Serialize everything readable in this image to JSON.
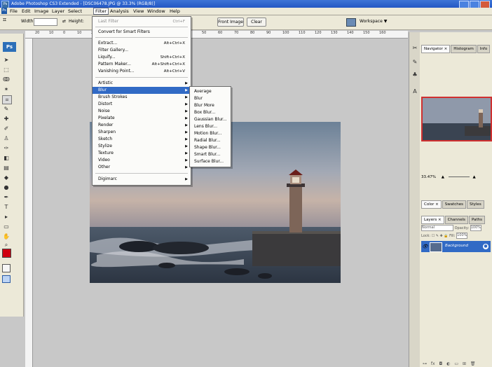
{
  "window": {
    "title": "Adobe Photoshop CS3 Extended - [DSC06478.JPG @ 33.3% (RGB/8)]",
    "icon_label": "Ps"
  },
  "menubar": {
    "items": [
      "File",
      "Edit",
      "Image",
      "Layer",
      "Select",
      "Filter",
      "Analysis",
      "View",
      "Window",
      "Help"
    ],
    "active": "Filter"
  },
  "options": {
    "width_label": "Width:",
    "height_label": "Height:",
    "front_image": "Front Image",
    "clear": "Clear",
    "workspace": "Workspace ▼"
  },
  "toolbox": {
    "logo": "Ps"
  },
  "ruler": {
    "ticks": [
      "20",
      "10",
      "0",
      "10",
      "20",
      "50",
      "60",
      "70",
      "80",
      "90",
      "100",
      "110",
      "120",
      "130",
      "140",
      "150",
      "160"
    ]
  },
  "filter_menu": {
    "last_filter": {
      "label": "Last Filter",
      "shortcut": "Ctrl+F"
    },
    "convert": "Convert for Smart Filters",
    "group1": [
      {
        "label": "Extract...",
        "shortcut": "Alt+Ctrl+X"
      },
      {
        "label": "Filter Gallery...",
        "shortcut": ""
      },
      {
        "label": "Liquify...",
        "shortcut": "Shift+Ctrl+X"
      },
      {
        "label": "Pattern Maker...",
        "shortcut": "Alt+Shift+Ctrl+X"
      },
      {
        "label": "Vanishing Point...",
        "shortcut": "Alt+Ctrl+V"
      }
    ],
    "group2": [
      "Artistic",
      "Blur",
      "Brush Strokes",
      "Distort",
      "Noise",
      "Pixelate",
      "Render",
      "Sharpen",
      "Sketch",
      "Stylize",
      "Texture",
      "Video",
      "Other"
    ],
    "selected": "Blur",
    "group3": [
      "Digimarc"
    ]
  },
  "blur_submenu": [
    "Average",
    "Blur",
    "Blur More",
    "Box Blur...",
    "Gaussian Blur...",
    "Lens Blur...",
    "Motion Blur...",
    "Radial Blur...",
    "Shape Blur...",
    "Smart Blur...",
    "Surface Blur..."
  ],
  "panels": {
    "nav_tabs": [
      "Navigator ×",
      "Histogram",
      "Info"
    ],
    "zoom": "33.47%",
    "color_tabs": [
      "Color ×",
      "Swatches",
      "Styles"
    ],
    "layer_tabs": [
      "Layers ×",
      "Channels",
      "Paths"
    ],
    "blend_mode": "Normal",
    "opacity_label": "Opacity:",
    "opacity": "100%",
    "lock_label": "Lock:",
    "fill_label": "Fill:",
    "fill": "100%",
    "layer_name": "Background"
  },
  "colors": {
    "accent": "#316ac5",
    "foreground": "#d00010"
  }
}
